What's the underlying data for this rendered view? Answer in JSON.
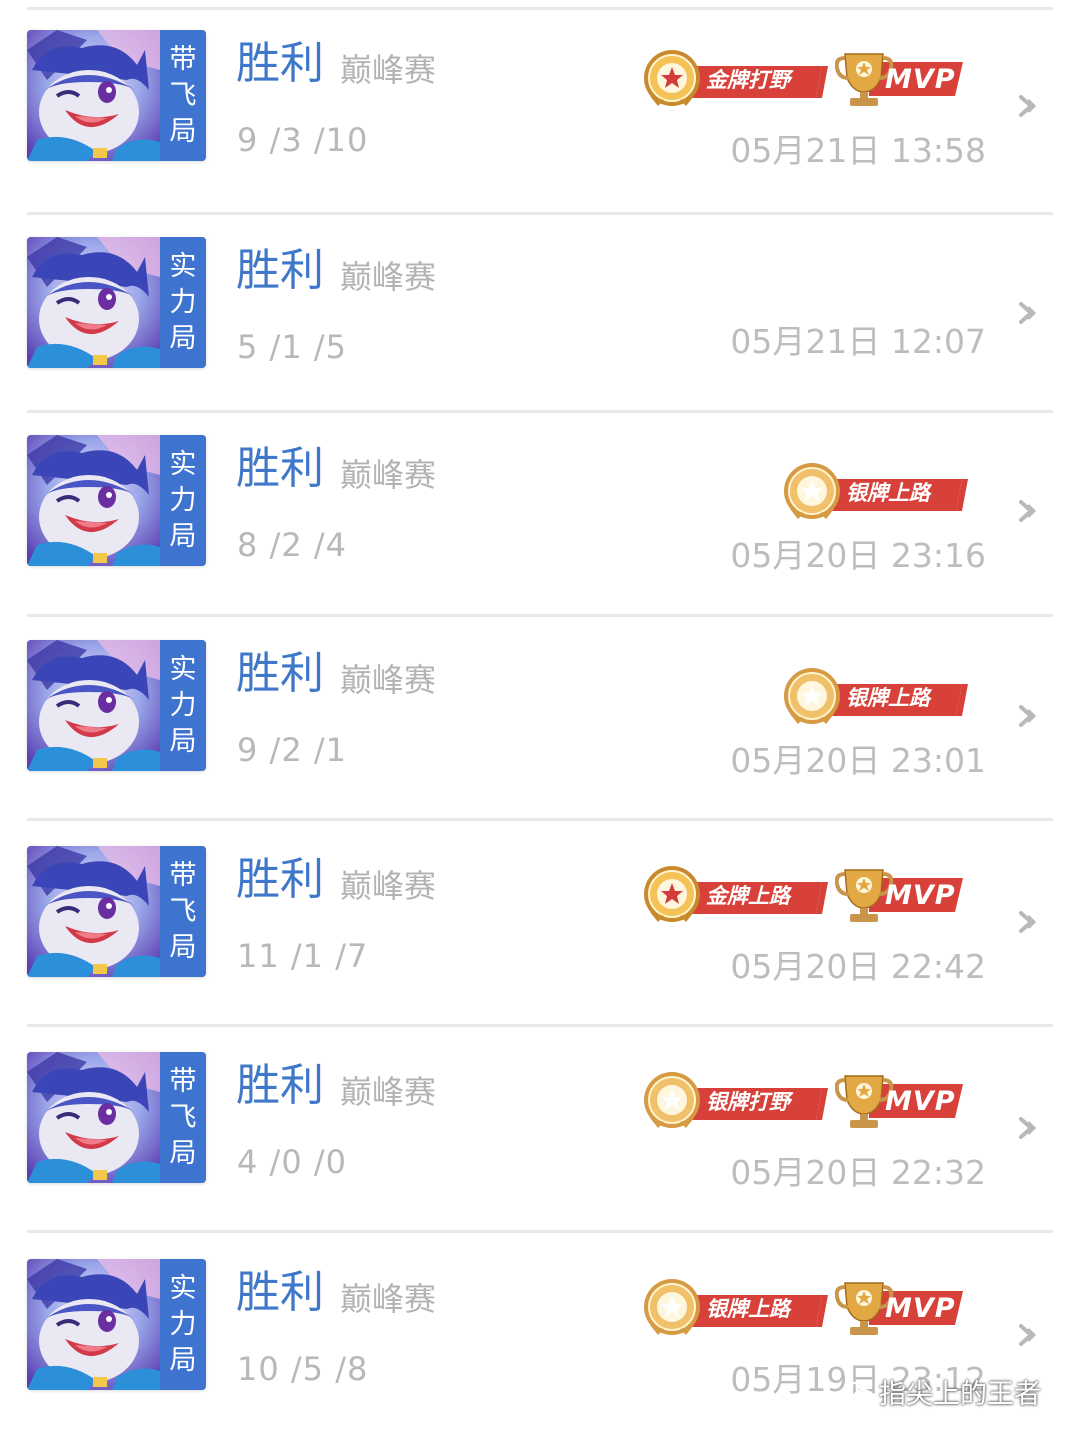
{
  "matches": [
    {
      "result": "胜利",
      "mode": "巅峰赛",
      "kda": "9 /3 /10",
      "time": "05月21日 13:58",
      "tag": [
        "带",
        "飞",
        "局"
      ],
      "badges": [
        {
          "kind": "medal",
          "tier": "gold",
          "label": "金牌打野"
        },
        {
          "kind": "mvp",
          "label": "MVP"
        }
      ]
    },
    {
      "result": "胜利",
      "mode": "巅峰赛",
      "kda": "5 /1 /5",
      "time": "05月21日 12:07",
      "tag": [
        "实",
        "力",
        "局"
      ],
      "badges": []
    },
    {
      "result": "胜利",
      "mode": "巅峰赛",
      "kda": "8 /2 /4",
      "time": "05月20日 23:16",
      "tag": [
        "实",
        "力",
        "局"
      ],
      "badges": [
        {
          "kind": "medal",
          "tier": "silver",
          "label": "银牌上路"
        }
      ]
    },
    {
      "result": "胜利",
      "mode": "巅峰赛",
      "kda": "9 /2 /1",
      "time": "05月20日 23:01",
      "tag": [
        "实",
        "力",
        "局"
      ],
      "badges": [
        {
          "kind": "medal",
          "tier": "silver",
          "label": "银牌上路"
        }
      ]
    },
    {
      "result": "胜利",
      "mode": "巅峰赛",
      "kda": "11 /1 /7",
      "time": "05月20日 22:42",
      "tag": [
        "带",
        "飞",
        "局"
      ],
      "badges": [
        {
          "kind": "medal",
          "tier": "gold",
          "label": "金牌上路"
        },
        {
          "kind": "mvp",
          "label": "MVP"
        }
      ]
    },
    {
      "result": "胜利",
      "mode": "巅峰赛",
      "kda": "4 /0 /0",
      "time": "05月20日 22:32",
      "tag": [
        "带",
        "飞",
        "局"
      ],
      "badges": [
        {
          "kind": "medal",
          "tier": "silver",
          "label": "银牌打野"
        },
        {
          "kind": "mvp",
          "label": "MVP"
        }
      ]
    },
    {
      "result": "胜利",
      "mode": "巅峰赛",
      "kda": "10 /5 /8",
      "time": "05月19日 23:12",
      "tag": [
        "实",
        "力",
        "局"
      ],
      "badges": [
        {
          "kind": "medal",
          "tier": "silver",
          "label": "银牌上路"
        },
        {
          "kind": "mvp",
          "label": "MVP"
        }
      ]
    }
  ],
  "watermark": {
    "text": "指尖上的王者",
    "icon": "wechat-icon"
  },
  "colors": {
    "result": "#3f78c9",
    "tag": "#3e74d0",
    "badge_red": "#d8413a",
    "badge_gold": "#c9954a",
    "muted": "#b8b8b8",
    "divider": "#e9e9e9"
  }
}
